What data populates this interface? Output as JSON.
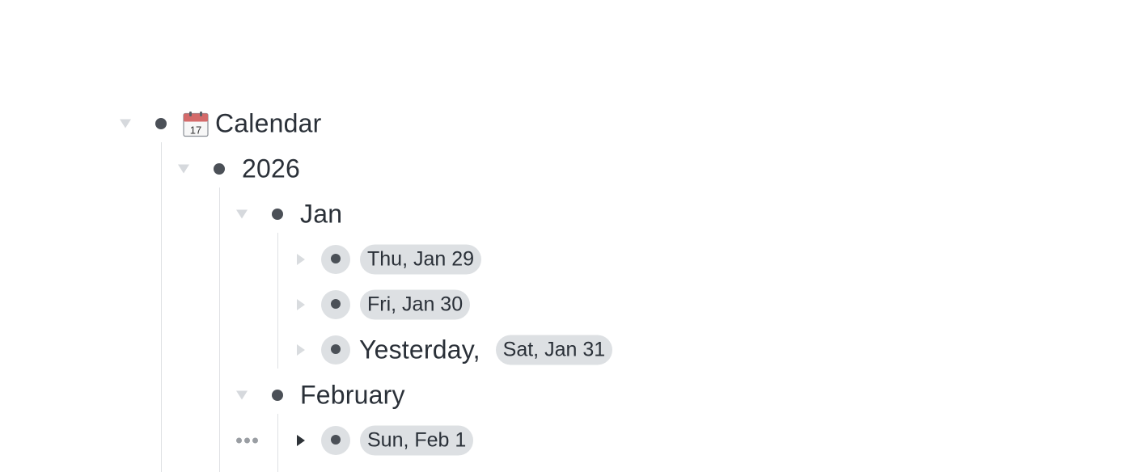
{
  "calendar": {
    "label": "Calendar",
    "icon": "calendar-icon",
    "icon_date": "17"
  },
  "year": {
    "label": "2026"
  },
  "months": [
    {
      "label": "Jan",
      "days": [
        {
          "prefix": "",
          "chip": "Thu, Jan 29"
        },
        {
          "prefix": "",
          "chip": "Fri, Jan 30"
        },
        {
          "prefix": "Yesterday,",
          "chip": "Sat, Jan 31"
        }
      ]
    },
    {
      "label": "February",
      "days": [
        {
          "prefix": "",
          "chip": "Sun, Feb 1"
        }
      ]
    }
  ],
  "colors": {
    "guide": "#dfe1e4",
    "chip_bg": "#dde0e3",
    "bullet": "#4b5057",
    "text": "#2a3038"
  }
}
